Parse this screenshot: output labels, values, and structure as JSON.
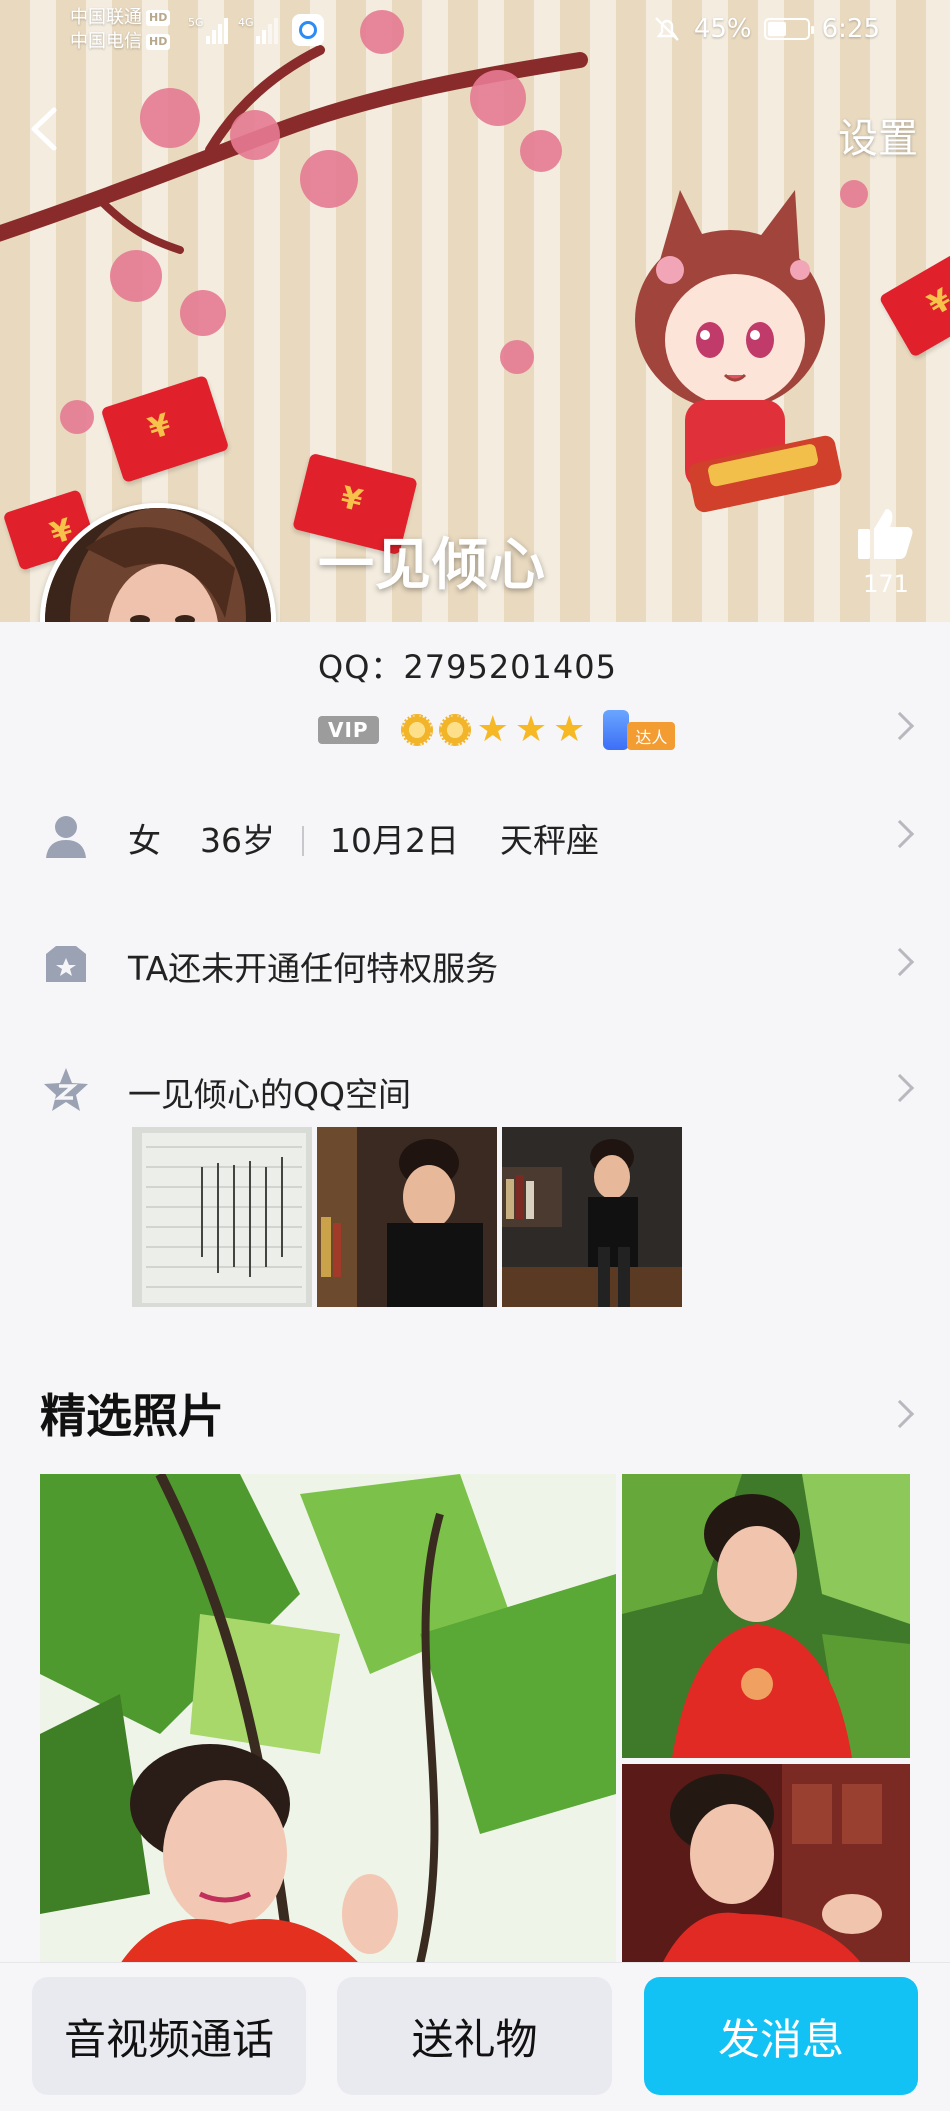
{
  "status_bar": {
    "carrier1": "中国联通",
    "carrier2": "中国电信",
    "hd": "HD",
    "net1": "5G",
    "net2": "4G",
    "battery": "45%",
    "time": "6:25"
  },
  "header": {
    "settings_label": "设置",
    "nickname": "一见倾心",
    "like_count": "171"
  },
  "profile": {
    "qq_line": "QQ：2795201405",
    "vip_label": "VIP",
    "daren_label": "达人",
    "gender": "女",
    "age": "36岁",
    "birthday": "10月2日",
    "zodiac": "天秤座",
    "privilege_text": "TA还未开通任何特权服务",
    "zone_text": "一见倾心的QQ空间"
  },
  "featured": {
    "title": "精选照片"
  },
  "bottom": {
    "call_label": "音视频通话",
    "gift_label": "送礼物",
    "message_label": "发消息"
  },
  "colors": {
    "accent": "#12C2F5",
    "vip_gray": "#9C9C9C",
    "star": "#F7B825",
    "red_envelope": "#E0202A"
  }
}
